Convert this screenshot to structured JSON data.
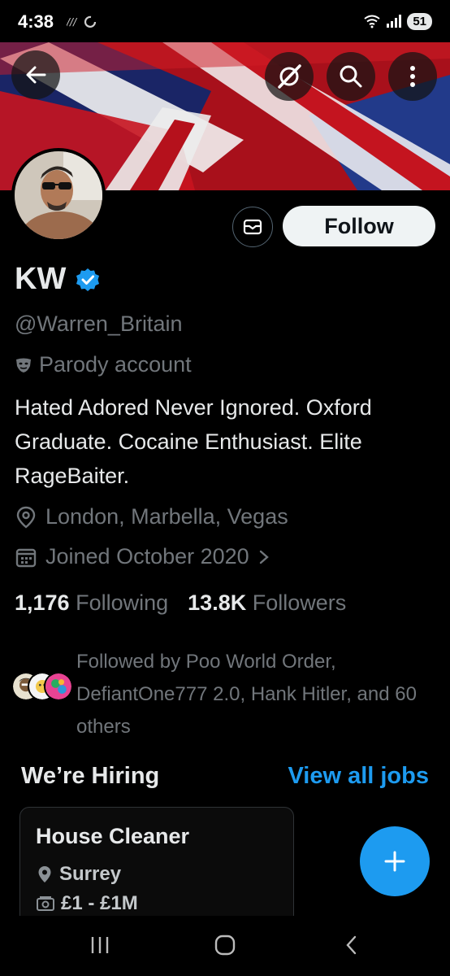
{
  "status_bar": {
    "time": "4:38",
    "battery": "51"
  },
  "header": {
    "icons": [
      "back-arrow-icon",
      "grok-icon",
      "search-icon",
      "more-vertical-icon"
    ]
  },
  "profile": {
    "display_name": "KW",
    "verified": true,
    "handle": "@Warren_Britain",
    "parody_label": "Parody account",
    "bio": "Hated Adored Never Ignored. Oxford Graduate. Cocaine Enthusiast. Elite RageBaiter.",
    "location": "London, Marbella, Vegas",
    "joined": "Joined October 2020",
    "following_count": "1,176",
    "following_label": "Following",
    "followers_count": "13.8K",
    "followers_label": "Followers",
    "follow_button": "Follow",
    "followed_by": "Followed by Poo World Order, DefiantOne777 2.0, Hank Hitler, and 60 others"
  },
  "hiring": {
    "title": "We’re Hiring",
    "view_all": "View all jobs",
    "job": {
      "title": "House Cleaner",
      "location": "Surrey",
      "pay": "£1 - £1M"
    }
  },
  "colors": {
    "accent": "#1d9bf0",
    "background": "#000000",
    "secondary_text": "#71767b"
  }
}
